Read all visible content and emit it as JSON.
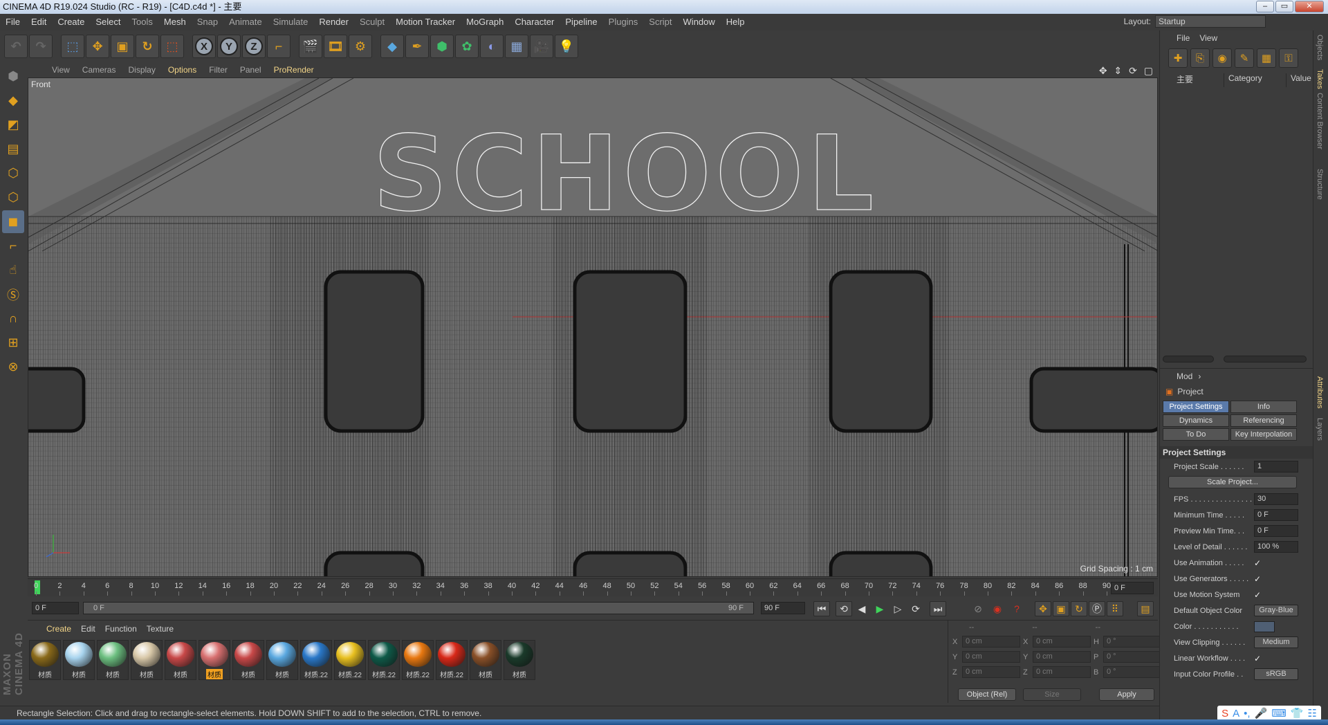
{
  "window": {
    "title": "CINEMA 4D R19.024 Studio (RC - R19) - [C4D.c4d *] - 主要",
    "buttons": [
      "–",
      "▭",
      "✕"
    ]
  },
  "menubar": {
    "items": [
      {
        "label": "File",
        "style": ""
      },
      {
        "label": "Edit",
        "style": ""
      },
      {
        "label": "Create",
        "style": ""
      },
      {
        "label": "Select",
        "style": ""
      },
      {
        "label": "Tools",
        "style": "dim"
      },
      {
        "label": "Mesh",
        "style": ""
      },
      {
        "label": "Snap",
        "style": "dim"
      },
      {
        "label": "Animate",
        "style": "dim"
      },
      {
        "label": "Simulate",
        "style": "dim"
      },
      {
        "label": "Render",
        "style": ""
      },
      {
        "label": "Sculpt",
        "style": "dim"
      },
      {
        "label": "Motion Tracker",
        "style": ""
      },
      {
        "label": "MoGraph",
        "style": ""
      },
      {
        "label": "Character",
        "style": ""
      },
      {
        "label": "Pipeline",
        "style": ""
      },
      {
        "label": "Plugins",
        "style": "dim"
      },
      {
        "label": "Script",
        "style": "dim"
      },
      {
        "label": "Window",
        "style": ""
      },
      {
        "label": "Help",
        "style": ""
      }
    ],
    "layout_label": "Layout:",
    "layout_value": "Startup"
  },
  "toolbar": {
    "icons": [
      "undo-icon",
      "redo-icon",
      "|",
      "select-icon",
      "move-icon",
      "scale-icon",
      "rotate-icon",
      "recent-tools-icon",
      "|",
      "x-axis-icon",
      "y-axis-icon",
      "z-axis-icon",
      "coordinate-system-icon",
      "|",
      "render-view-icon",
      "render-picture-viewer-icon",
      "edit-render-settings-icon",
      "|",
      "cube-icon",
      "pen-spline-icon",
      "subdivision-icon",
      "cloner-icon",
      "deformer-icon",
      "floor-icon",
      "camera-icon",
      "light-icon"
    ],
    "axis_labels": [
      "X",
      "Y",
      "Z"
    ]
  },
  "left_tools": [
    "make-editable-icon",
    "model-mode-icon",
    "texture-mode-icon",
    "workplane-icon",
    "points-mode-icon",
    "edges-mode-icon",
    "polygons-mode-icon",
    "axis-mode-icon",
    "tweak-icon",
    "solo-icon",
    "snap-icon",
    "locked-workplane-icon",
    "planar-workplane-icon"
  ],
  "brand": "MAXON CINEMA 4D",
  "viewport": {
    "menu": [
      {
        "label": "View",
        "style": ""
      },
      {
        "label": "Cameras",
        "style": ""
      },
      {
        "label": "Display",
        "style": ""
      },
      {
        "label": "Options",
        "style": "hl"
      },
      {
        "label": "Filter",
        "style": ""
      },
      {
        "label": "Panel",
        "style": ""
      },
      {
        "label": "ProRender",
        "style": "hl"
      }
    ],
    "nav_icons": "✥ ⇕ ⟳ ▢",
    "view_name": "Front",
    "text_object": "SCHOOL",
    "grid_spacing": "Grid Spacing : 1 cm"
  },
  "timeline": {
    "frames": [
      "0",
      "2",
      "4",
      "6",
      "8",
      "10",
      "12",
      "14",
      "16",
      "18",
      "20",
      "22",
      "24",
      "26",
      "28",
      "30",
      "32",
      "34",
      "36",
      "38",
      "40",
      "42",
      "44",
      "46",
      "48",
      "50",
      "52",
      "54",
      "56",
      "58",
      "60",
      "62",
      "64",
      "66",
      "68",
      "70",
      "72",
      "74",
      "76",
      "78",
      "80",
      "82",
      "84",
      "86",
      "88",
      "90"
    ],
    "current_frame": "0 F",
    "start_field": "0 F",
    "slider_start": "0 F",
    "slider_end": "90 F",
    "end_field": "90 F"
  },
  "material_panel": {
    "menu": [
      {
        "label": "Create",
        "style": "hl"
      },
      {
        "label": "Edit",
        "style": ""
      },
      {
        "label": "Function",
        "style": ""
      },
      {
        "label": "Texture",
        "style": ""
      }
    ],
    "materials": [
      {
        "name": "材质",
        "color": "#8a6a1a",
        "selected": false
      },
      {
        "name": "材质",
        "color": "#a8d4ee",
        "selected": false
      },
      {
        "name": "材质",
        "color": "#6cbf80",
        "selected": false
      },
      {
        "name": "材质",
        "color": "#d8c8a8",
        "selected": false
      },
      {
        "name": "材质",
        "color": "#c84848",
        "selected": false
      },
      {
        "name": "材质",
        "color": "#d87070",
        "selected": true
      },
      {
        "name": "材质",
        "color": "#c84848",
        "selected": false
      },
      {
        "name": "材质",
        "color": "#5aa8e0",
        "selected": false
      },
      {
        "name": "材质.22",
        "color": "#2a78c8",
        "selected": false
      },
      {
        "name": "材质.22",
        "color": "#e8c020",
        "selected": false
      },
      {
        "name": "材质.22",
        "color": "#0e5a48",
        "selected": false
      },
      {
        "name": "材质.22",
        "color": "#e87810",
        "selected": false
      },
      {
        "name": "材质.22",
        "color": "#d82818",
        "selected": false
      },
      {
        "name": "材质",
        "color": "#8a5028",
        "selected": false
      },
      {
        "name": "材质",
        "color": "#1a3a2a",
        "selected": false
      }
    ]
  },
  "coordinates": {
    "headers": [
      "--",
      "--",
      "--"
    ],
    "rows": [
      {
        "a": "X",
        "av": "0 cm",
        "b": "X",
        "bv": "0 cm",
        "c": "H",
        "cv": "0 °"
      },
      {
        "a": "Y",
        "av": "0 cm",
        "b": "Y",
        "bv": "0 cm",
        "c": "P",
        "cv": "0 °"
      },
      {
        "a": "Z",
        "av": "0 cm",
        "b": "Z",
        "bv": "0 cm",
        "c": "B",
        "cv": "0 °"
      }
    ],
    "mode": "Object (Rel)",
    "size": "Size",
    "apply": "Apply"
  },
  "status": "Rectangle Selection: Click and drag to rectangle-select elements. Hold DOWN SHIFT to add to the selection, CTRL to remove.",
  "takes_panel": {
    "menu": [
      "File",
      "View"
    ],
    "col_main": "主要",
    "col_category": "Category",
    "col_value": "Value"
  },
  "attributes": {
    "menu": "Mod",
    "title": "Project",
    "tabs": [
      {
        "label": "Project Settings",
        "on": true
      },
      {
        "label": "Info",
        "on": false
      },
      {
        "label": "Dynamics",
        "on": false
      },
      {
        "label": "Referencing",
        "on": false
      },
      {
        "label": "To Do",
        "on": false
      },
      {
        "label": "Key Interpolation",
        "on": false
      }
    ],
    "section": "Project Settings",
    "project_scale_label": "Project Scale . . . . . .",
    "project_scale": "1",
    "scale_button": "Scale Project...",
    "fps_label": "FPS . . . . . . . . . . . . . . .",
    "fps": "30",
    "min_time_label": "Minimum Time . . . . .",
    "min_time": "0 F",
    "preview_min_label": "Preview Min Time. . .",
    "preview_min": "0 F",
    "lod_label": "Level of Detail . . . . . .",
    "lod": "100 %",
    "use_anim_label": "Use Animation . . . . .",
    "use_gen_label": "Use Generators . . . . .",
    "use_motion_label": "Use Motion System",
    "check": "✓",
    "def_color_label": "Default Object Color",
    "def_color": "Gray-Blue",
    "color_label": "Color . . . . . . . . . . .",
    "view_clip_label": "View Clipping . . . . . .",
    "view_clip": "Medium",
    "linear_label": "Linear Workflow . . . .",
    "input_profile_label": "Input Color Profile . .",
    "input_profile": "sRGB"
  },
  "side_tabs": [
    "Objects",
    "Takes",
    "Content Browser",
    "Structure",
    "Attributes",
    "Layers"
  ],
  "ime": [
    "S",
    "A",
    "•,",
    "🎤",
    "⌨",
    "👕",
    "☷"
  ]
}
